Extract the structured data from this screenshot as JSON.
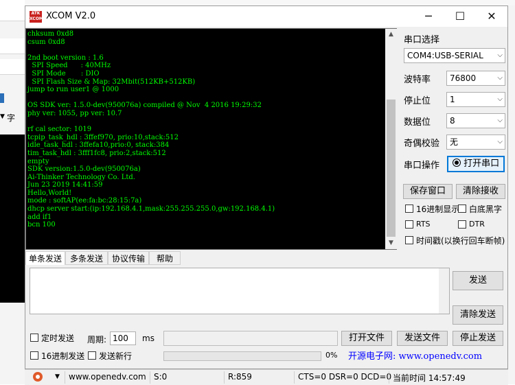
{
  "window": {
    "title": "XCOM V2.0",
    "logo_text": "ATK XCOM",
    "controls": {
      "minimize": "─",
      "maximize": "☐",
      "close": "✕"
    }
  },
  "background": {
    "left_tag": "字"
  },
  "terminal": {
    "output": "chksum 0xd8\ncsum 0xd8\n\n2nd boot version : 1.6\n  SPI Speed      : 40MHz\n  SPI Mode       : DIO\n  SPI Flash Size & Map: 32Mbit(512KB+512KB)\njump to run user1 @ 1000\n\nOS SDK ver: 1.5.0-dev(950076a) compiled @ Nov  4 2016 19:29:32\nphy ver: 1055, pp ver: 10.7\n\nrf cal sector: 1019\ntcpip_task_hdl : 3ffef970, prio:10,stack:512\nidle_task_hdl : 3ffefa10,prio:0, stack:384\ntim_task_hdl : 3fff1fc8, prio:2,stack:512\nempty\nSDK version:1.5.0-dev(950076a)\nAi-Thinker Technology Co. Ltd.\nJun 23 2019 14:41:59\nHello,World!\nmode : softAP(ee:fa:bc:28:15:7a)\ndhcp server start:(ip:192.168.4.1,mask:255.255.255.0,gw:192.168.4.1)\nadd if1\nbcn 100"
  },
  "serial": {
    "port_label": "串口选择",
    "port_value": "COM4:USB-SERIAL",
    "baud_label": "波特率",
    "baud_value": "76800",
    "stop_label": "停止位",
    "stop_value": "1",
    "data_label": "数据位",
    "data_value": "8",
    "parity_label": "奇偶校验",
    "parity_value": "无",
    "op_label": "串口操作",
    "open_button": "打开串口"
  },
  "receive": {
    "save_window": "保存窗口",
    "clear_receive": "清除接收",
    "hex_display": "16进制显示",
    "white_black": "白底黑字",
    "rts": "RTS",
    "dtr": "DTR",
    "timestamp": "时间戳(以换行回车断帧)"
  },
  "tabs": [
    "单条发送",
    "多条发送",
    "协议传输",
    "帮助"
  ],
  "send": {
    "send_button": "发送",
    "clear_send": "清除发送",
    "timed_send": "定时发送",
    "period_label": "周期:",
    "period_value": "100",
    "period_unit": "ms",
    "open_file": "打开文件",
    "send_file": "发送文件",
    "stop_send": "停止发送",
    "hex_send": "16进制发送",
    "send_newline": "发送新行",
    "progress_text": "0%",
    "progress_value": 0,
    "website": "开源电子网: www.openedv.com"
  },
  "status_bar": {
    "url": "www.openedv.com",
    "sent": "S:0",
    "received": "R:859",
    "signals": "CTS=0 DSR=0 DCD=0",
    "time": "当前时间 14:57:49"
  }
}
